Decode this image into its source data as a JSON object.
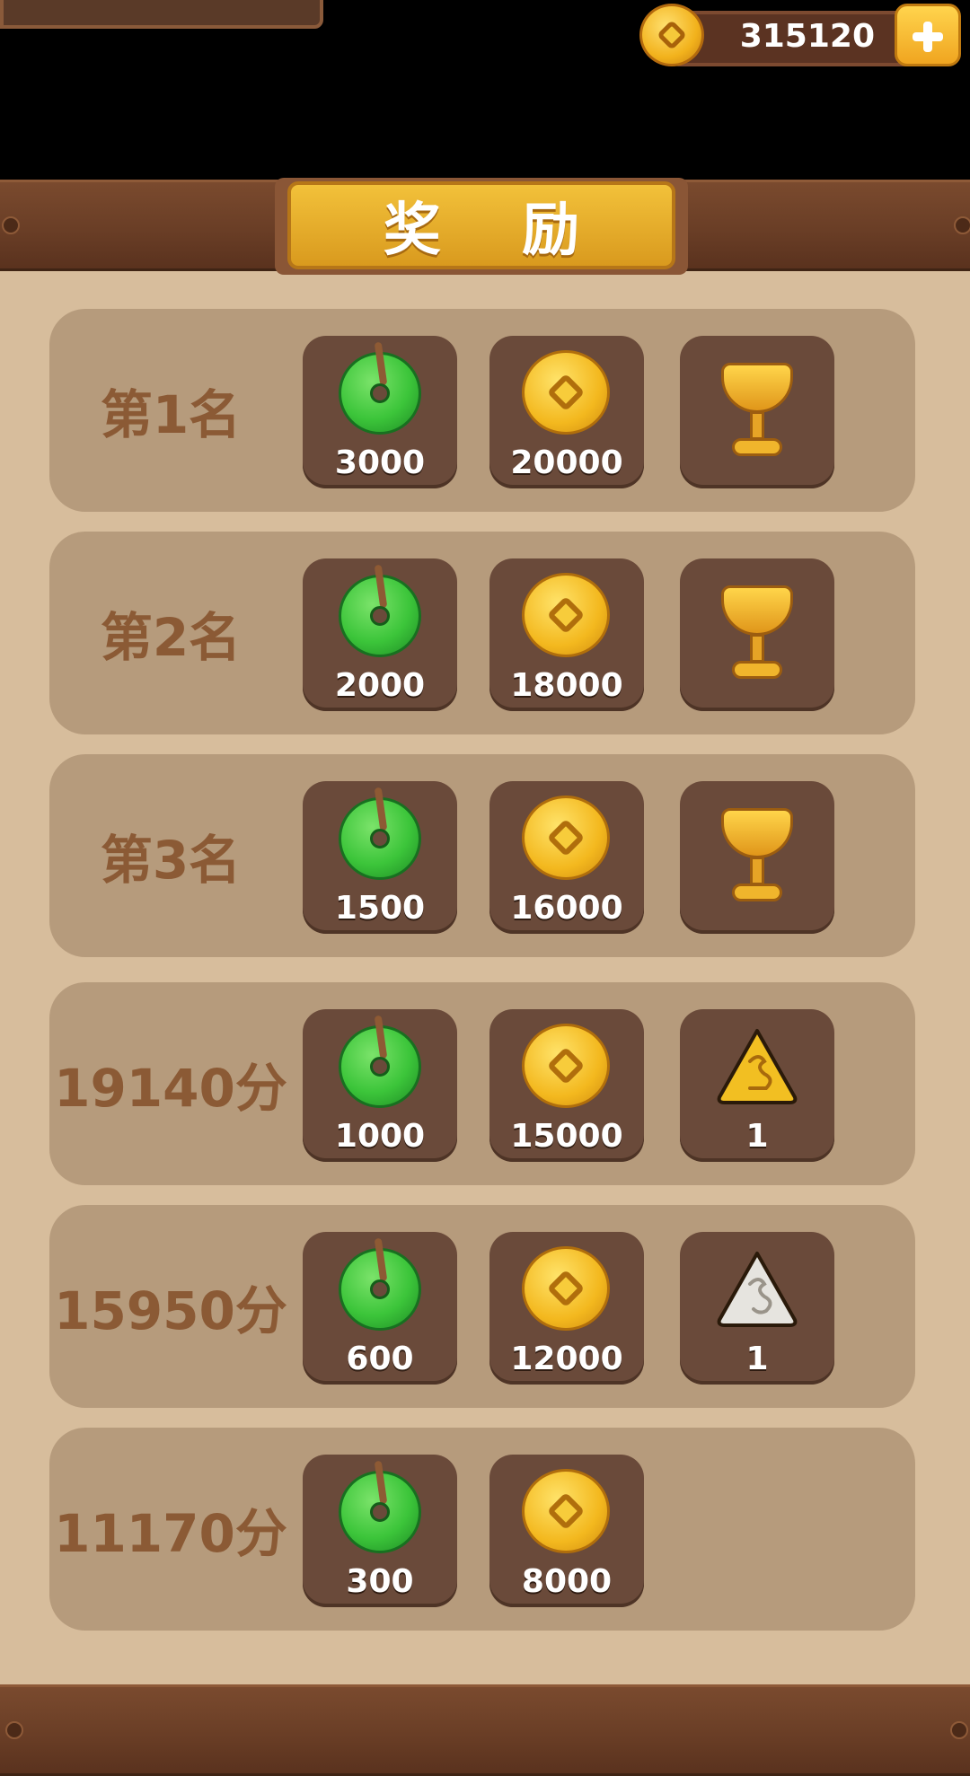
{
  "header": {
    "coin_balance": "315120"
  },
  "panel": {
    "title": "奖 励"
  },
  "rewards": [
    {
      "rank_label": "第1名",
      "items": [
        {
          "icon": "jade-icon",
          "qty": "3000"
        },
        {
          "icon": "coin-icon",
          "qty": "20000"
        },
        {
          "icon": "cup-icon",
          "qty": ""
        }
      ]
    },
    {
      "rank_label": "第2名",
      "items": [
        {
          "icon": "jade-icon",
          "qty": "2000"
        },
        {
          "icon": "coin-icon",
          "qty": "18000"
        },
        {
          "icon": "cup-icon",
          "qty": ""
        }
      ]
    },
    {
      "rank_label": "第3名",
      "items": [
        {
          "icon": "jade-icon",
          "qty": "1500"
        },
        {
          "icon": "coin-icon",
          "qty": "16000"
        },
        {
          "icon": "cup-icon",
          "qty": ""
        }
      ]
    },
    {
      "rank_label": "19140分",
      "items": [
        {
          "icon": "jade-icon",
          "qty": "1000"
        },
        {
          "icon": "coin-icon",
          "qty": "15000"
        },
        {
          "icon": "gold-token-icon",
          "qty": "1"
        }
      ]
    },
    {
      "rank_label": "15950分",
      "items": [
        {
          "icon": "jade-icon",
          "qty": "600"
        },
        {
          "icon": "coin-icon",
          "qty": "12000"
        },
        {
          "icon": "silver-token-icon",
          "qty": "1"
        }
      ]
    },
    {
      "rank_label": "11170分",
      "items": [
        {
          "icon": "jade-icon",
          "qty": "300"
        },
        {
          "icon": "coin-icon",
          "qty": "8000"
        }
      ]
    }
  ],
  "colors": {
    "panel_bg": "#d7bd9c",
    "row_bg": "#b69b7c",
    "slot_bg": "#6a4a3a",
    "rank_text": "#8b5a35",
    "title_plate": "#e8ad2a"
  }
}
